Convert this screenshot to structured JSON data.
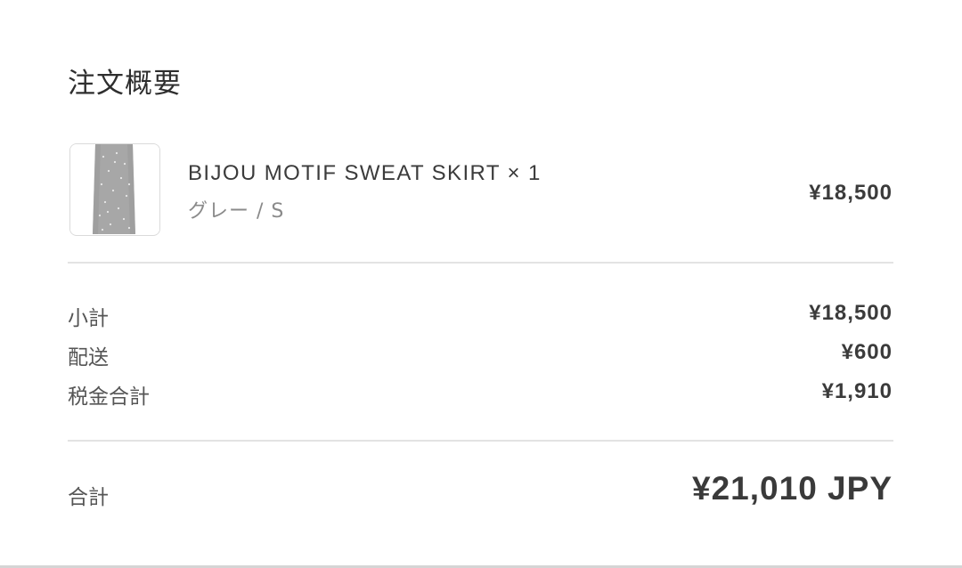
{
  "summary": {
    "title": "注文概要"
  },
  "product": {
    "name": "BIJOU MOTIF SWEAT SKIRT × 1",
    "variant": "グレー / S",
    "price": "¥18,500",
    "image_icon": "skirt-thumbnail"
  },
  "breakdown": [
    {
      "label": "小計",
      "value": "¥18,500"
    },
    {
      "label": "配送",
      "value": "¥600"
    },
    {
      "label": "税金合計",
      "value": "¥1,910"
    }
  ],
  "total": {
    "label": "合計",
    "value": "¥21,010 JPY"
  },
  "colors": {
    "text_primary": "#3b3b3b",
    "text_muted": "#8a8a8a",
    "divider": "#e3e3e3",
    "thumb_fabric": "#a9a9a9"
  }
}
